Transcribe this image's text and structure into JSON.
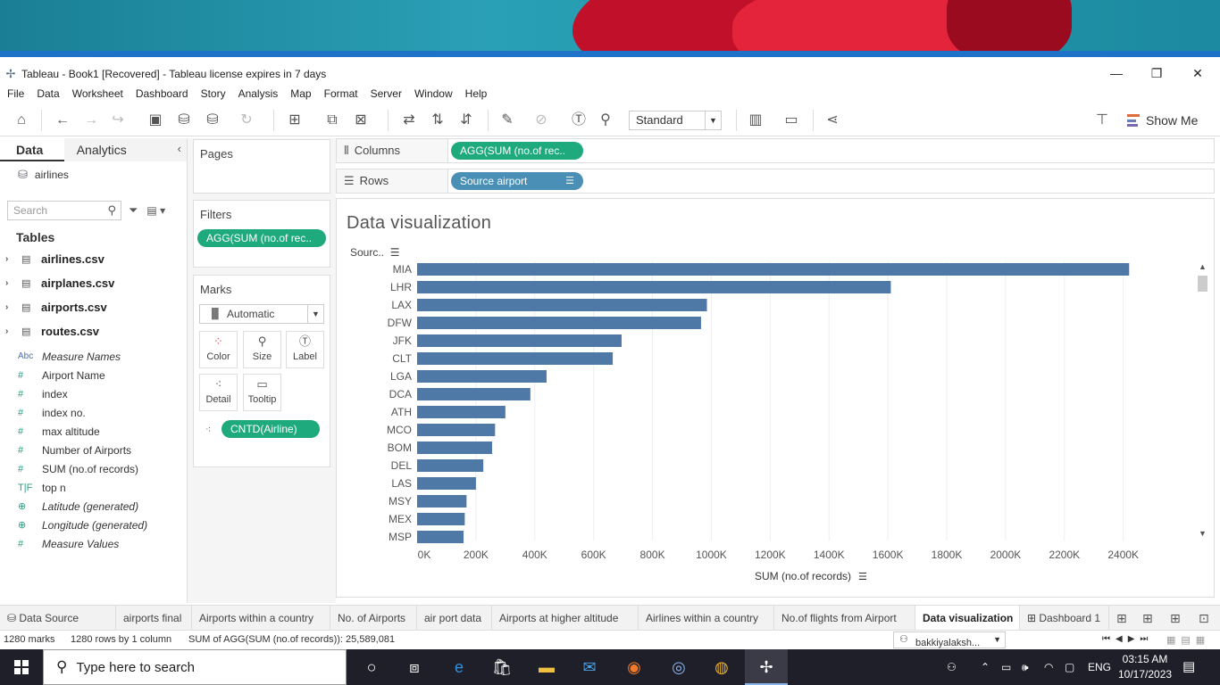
{
  "window": {
    "title": "Tableau - Book1 [Recovered] - Tableau license expires in 7 days",
    "minimize": "—",
    "restore": "❐",
    "close": "✕"
  },
  "menu": [
    "File",
    "Data",
    "Worksheet",
    "Dashboard",
    "Story",
    "Analysis",
    "Map",
    "Format",
    "Server",
    "Window",
    "Help"
  ],
  "toolbar": {
    "fit": "Standard",
    "show_me": "Show Me"
  },
  "data_pane": {
    "tab_data": "Data",
    "tab_analytics": "Analytics",
    "datasource": "airlines",
    "search_placeholder": "Search",
    "tables_heading": "Tables",
    "tables": [
      "airlines.csv",
      "airplanes.csv",
      "airports.csv",
      "routes.csv"
    ],
    "fields": [
      {
        "icon": "Abc",
        "label": "Measure Names",
        "italic": true,
        "kind": "abc"
      },
      {
        "icon": "#",
        "label": "Airport Name",
        "italic": false,
        "kind": "measure"
      },
      {
        "icon": "#",
        "label": "index",
        "italic": false,
        "kind": "measure"
      },
      {
        "icon": "#",
        "label": "index no.",
        "italic": false,
        "kind": "measure"
      },
      {
        "icon": "#",
        "label": "max altitude",
        "italic": false,
        "kind": "measure"
      },
      {
        "icon": "#",
        "label": "Number of Airports",
        "italic": false,
        "kind": "measure"
      },
      {
        "icon": "#",
        "label": "SUM (no.of records)",
        "italic": false,
        "kind": "measure"
      },
      {
        "icon": "T|F",
        "label": "top n",
        "italic": false,
        "kind": "bool"
      },
      {
        "icon": "⊕",
        "label": "Latitude (generated)",
        "italic": true,
        "kind": "globe"
      },
      {
        "icon": "⊕",
        "label": "Longitude (generated)",
        "italic": true,
        "kind": "globe"
      },
      {
        "icon": "#",
        "label": "Measure Values",
        "italic": true,
        "kind": "measure"
      }
    ]
  },
  "cards": {
    "pages_title": "Pages",
    "filters_title": "Filters",
    "filter_pill": "AGG(SUM (no.of rec..",
    "marks_title": "Marks",
    "mark_type": "Automatic",
    "mark_buttons": [
      "Color",
      "Size",
      "Label",
      "Detail",
      "Tooltip"
    ],
    "marks_pill": "CNTD(Airline)"
  },
  "shelves": {
    "columns_label": "Columns",
    "columns_pill": "AGG(SUM (no.of rec..",
    "rows_label": "Rows",
    "rows_pill": "Source airport"
  },
  "viz": {
    "title": "Data visualization",
    "row_header": "Sourc..",
    "xlabel": "SUM (no.of records)"
  },
  "chart_data": {
    "type": "bar",
    "orientation": "horizontal",
    "title": "Data visualization",
    "xlabel": "SUM (no.of records)",
    "ylabel": "Sourc..",
    "categories": [
      "MIA",
      "LHR",
      "LAX",
      "DFW",
      "JFK",
      "CLT",
      "LGA",
      "DCA",
      "ATH",
      "MCO",
      "BOM",
      "DEL",
      "LAS",
      "MSY",
      "MEX",
      "MSP"
    ],
    "values": [
      2420000,
      1610000,
      985000,
      965000,
      695000,
      665000,
      440000,
      385000,
      300000,
      265000,
      255000,
      225000,
      200000,
      168000,
      162000,
      158000
    ],
    "x_ticks": [
      "0K",
      "200K",
      "400K",
      "600K",
      "800K",
      "1000K",
      "1200K",
      "1400K",
      "1600K",
      "1800K",
      "2000K",
      "2200K",
      "2400K"
    ],
    "xlim": [
      0,
      2580000
    ],
    "bar_color": "#4e79a7",
    "grid": true
  },
  "sheet_tabs": [
    "Data Source",
    "airports final",
    "Airports within a country",
    "No. of Airports",
    "air port data",
    "Airports at higher altitude",
    "Airlines within a country",
    "No.of flights from Airport",
    "Data visualization",
    "Dashboard 1"
  ],
  "status": {
    "marks": "1280 marks",
    "rows_cols": "1280 rows by 1 column",
    "sum": "SUM of AGG(SUM (no.of records)): 25,589,081",
    "user": "bakkiyalaksh..."
  },
  "taskbar": {
    "search_placeholder": "Type here to search",
    "language": "ENG",
    "time": "03:15 AM",
    "date": "10/17/2023"
  },
  "colors": {
    "green_pill": "#1faa7e",
    "blue_pill": "#4a8fb5",
    "bar": "#4e79a7"
  }
}
